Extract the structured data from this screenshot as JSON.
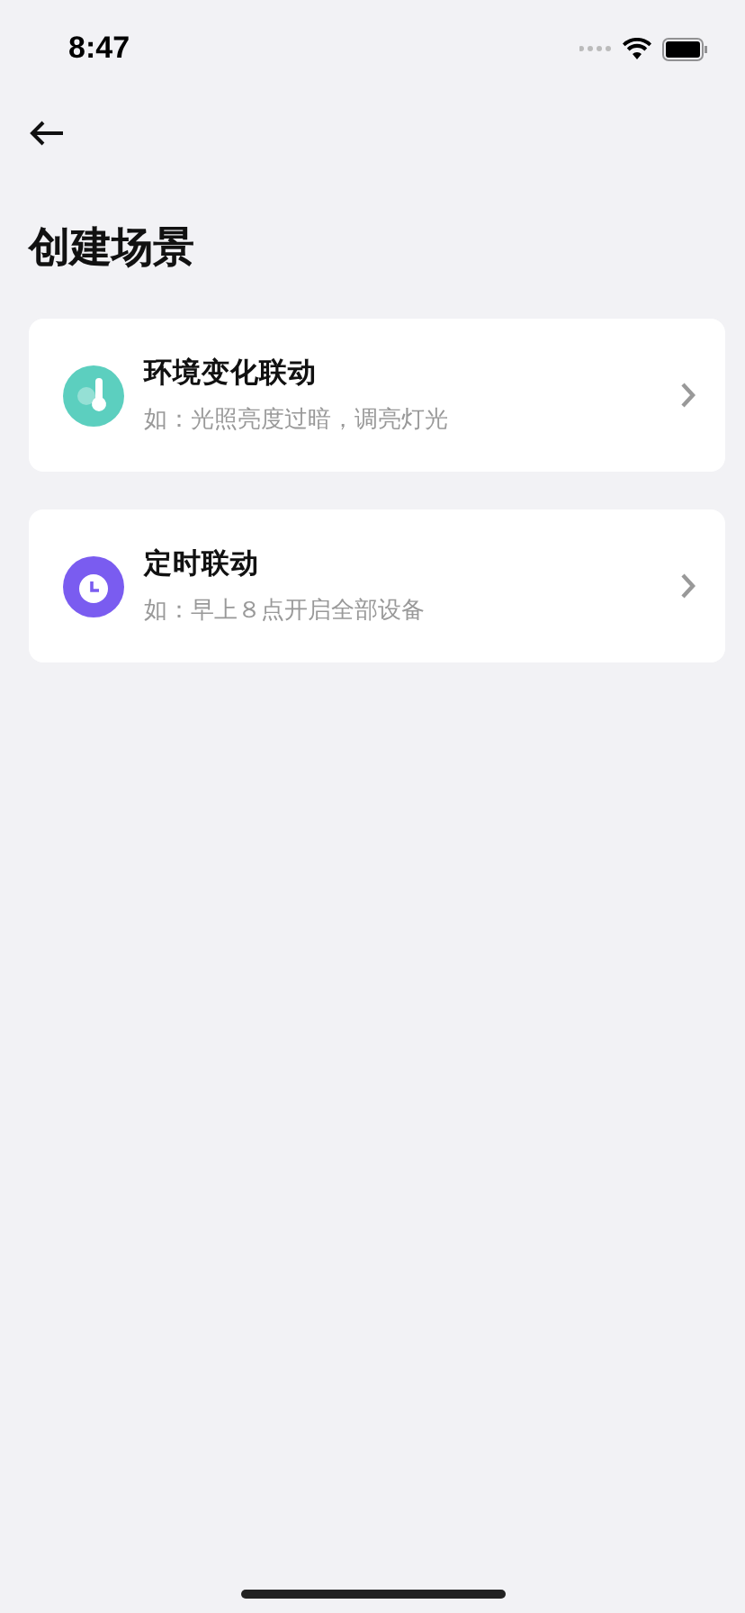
{
  "status_bar": {
    "time": "8:47"
  },
  "title": "创建场景",
  "options": [
    {
      "kind": "environment",
      "color": "#5ccfbf",
      "title": "环境变化联动",
      "example": "如：光照亮度过暗，调亮灯光"
    },
    {
      "kind": "timer",
      "color": "#7a5cf0",
      "title": "定时联动",
      "example": "如：早上８点开启全部设备"
    }
  ]
}
